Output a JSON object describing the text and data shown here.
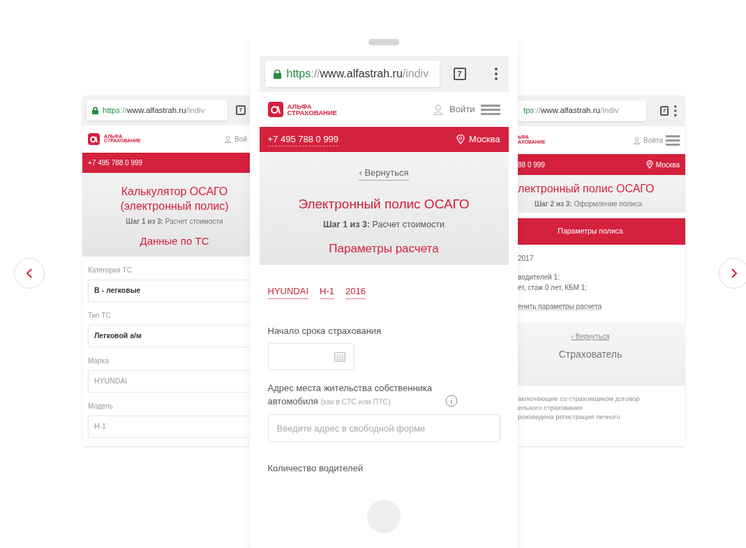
{
  "left_screen": {
    "url_parts": [
      {
        "kind": "scheme",
        "text": "https"
      },
      {
        "kind": "sep",
        "text": "://"
      },
      {
        "kind": "host",
        "text": "www.alfastrah.ru"
      },
      {
        "kind": "path",
        "text": "/indiv"
      }
    ],
    "tab_count": "7",
    "logo": [
      "АЛЬФА",
      "СТРАХОВАНИЕ"
    ],
    "login": "Вой",
    "phone": "+7 495 788 0 999",
    "title": "Калькулятор ОСАГО (электронный полис)",
    "step": "**Шаг 1 из 3:** Расчет стоимости",
    "section": "Данные по ТС",
    "fields": [
      {
        "label": "Категория ТС",
        "value": "В - легковые",
        "kind": "filled"
      },
      {
        "label": "Тип ТС",
        "value": "Легковой а/м",
        "kind": "filled"
      },
      {
        "label": "Марка",
        "value": "HYUNDAI",
        "kind": "muted"
      },
      {
        "label": "Модель",
        "value": "H-1",
        "kind": "muted"
      }
    ]
  },
  "center_screen": {
    "url_parts": [
      {
        "kind": "scheme",
        "text": "https"
      },
      {
        "kind": "sep",
        "text": "://"
      },
      {
        "kind": "host",
        "text": "www.alfastrah.ru"
      },
      {
        "kind": "path",
        "text": "/indiv"
      }
    ],
    "tab_count": "7",
    "logo": [
      "АЛЬФА",
      "СТРАХОВАНИЕ"
    ],
    "login": "Войти",
    "phone": "+7 495 788 0 999",
    "city": "Москва",
    "back_link": "‹ Вернуться",
    "title": "Электронный полис ОСАГО",
    "step": "**Шаг 1 из 3:** Расчет стоимости",
    "section": "Параметры расчета",
    "car_links": [
      "HYUNDAI",
      "H-1",
      "2016"
    ],
    "start_label": "Начало срока страхования",
    "address_label": "Адрес места жительства собственника автомобиля",
    "address_hint": "(как в СТС или ПТС)",
    "address_field": {
      "placeholder": "Введите адрес в свободной форме"
    },
    "drivers_label": "Количество водителей"
  },
  "right_screen": {
    "url_parts": [
      {
        "kind": "scheme",
        "text": "tps"
      },
      {
        "kind": "sep",
        "text": "://"
      },
      {
        "kind": "host",
        "text": "www.alfastrah.ru"
      },
      {
        "kind": "path",
        "text": "/indiv"
      }
    ],
    "tab_count": "7",
    "logo": [
      "ЬФА",
      "АХОВАНИЕ"
    ],
    "login": "Войти",
    "phone": "88 0 999",
    "city": "Москва",
    "title": "лектронный полис ОСАГО",
    "step": "**Шаг 2 из 3:** Оформление полиса",
    "band": "Параметры полиса",
    "summary": [
      "2017",
      "водителей 1:",
      "ет, стаж 0 лет, КБМ 1;"
    ],
    "change_link": "енить параметры расчета",
    "back_link": "‹ Вернуться",
    "section": "Страхователь",
    "faded_lines": [
      "аключающее со страховщиком договор",
      "ельного страхования",
      "роизведена регистрация личного"
    ]
  }
}
